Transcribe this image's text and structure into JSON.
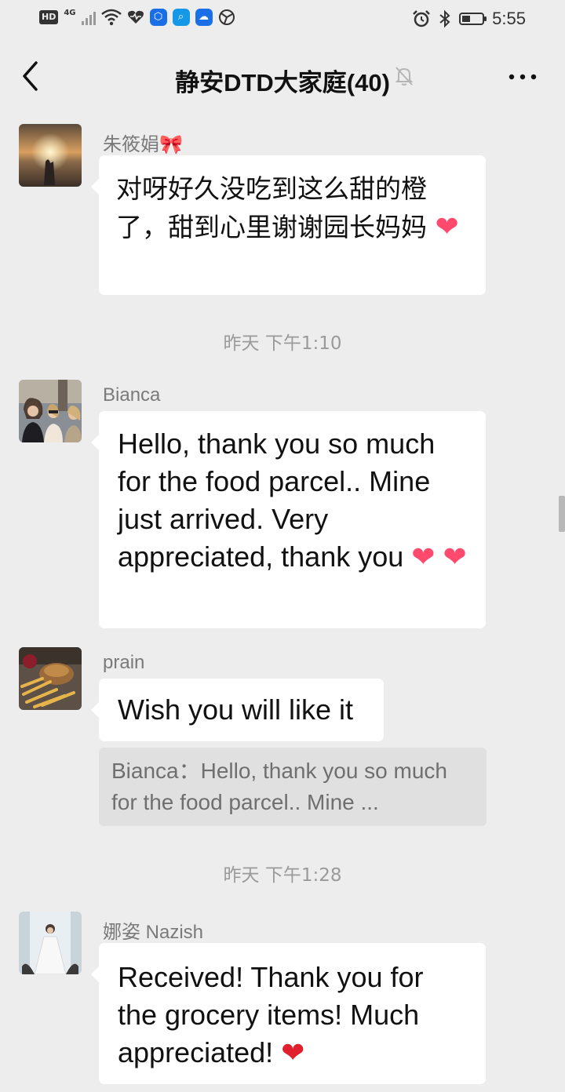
{
  "status_bar": {
    "hd": "HD",
    "network": "4G",
    "time": "5:55",
    "icons": [
      "signal-icon",
      "wifi-icon",
      "heart-rate-icon",
      "app-icon",
      "search-app-icon",
      "cloud-icon",
      "globe-icon",
      "alarm-icon",
      "bluetooth-icon",
      "battery-icon"
    ]
  },
  "header": {
    "title": "静安DTD大家庭(40)",
    "back_icon": "chevron-left-icon",
    "mute_icon": "bell-muted-icon",
    "more_icon": "more-icon"
  },
  "messages": [
    {
      "sender": "朱筱娟",
      "sender_emoji": "🎀",
      "text": "对呀好久没吃到这么甜的橙了，甜到心里谢谢园长妈妈",
      "emoji": "❤"
    },
    {
      "sender": "Bianca",
      "text": "Hello, thank you so much for the food parcel.. Mine just arrived. Very appreciated, thank you",
      "emoji": "❤",
      "emoji2": "❤"
    },
    {
      "sender": "prain",
      "text": "Wish you will like it",
      "quote": "Bianca：Hello, thank you so much for the food parcel.. Mine ..."
    },
    {
      "sender": "娜姿 Nazish",
      "text": "Received! Thank you for the grocery items! Much appreciated!",
      "emoji": "❤"
    }
  ],
  "timestamps": [
    "昨天 下午1:10",
    "昨天 下午1:28"
  ],
  "colors": {
    "background": "#ededed",
    "bubble": "#ffffff",
    "heart_pink": "#ff4a6e",
    "heart_red": "#e0202e"
  }
}
